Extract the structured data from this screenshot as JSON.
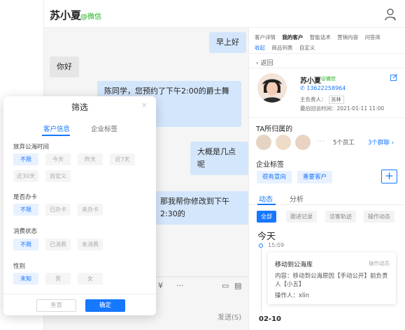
{
  "chat": {
    "contact_name": "苏小夏",
    "contact_tag": "@微信",
    "messages": [
      {
        "from": "me",
        "text": "早上好"
      },
      {
        "from": "other",
        "text": "你好"
      },
      {
        "from": "me",
        "text": "陈同学，您预约了下午2:00的爵士舞基础课程",
        "text2": "课噢"
      },
      {
        "from": "me",
        "text": "大概是几点呢"
      },
      {
        "from": "me",
        "text": "那我帮你修改到下午2:30的"
      }
    ],
    "send_label": "发送(S)"
  },
  "panel": {
    "tabs": [
      "客户详情",
      "我的客户",
      "智能话术",
      "营销内容",
      "问答库",
      "收起",
      "商品列表",
      "自定义"
    ],
    "active_tab": "我的客户",
    "back_label": "返回",
    "profile": {
      "name": "苏小夏",
      "tag": "@微信",
      "phone": "13622258964",
      "owner_label": "主负责人：",
      "owner": "苏林",
      "last_visit_label": "最后回访时间：",
      "last_visit": "2021-01-11 11:00"
    },
    "belongs_title": "TA所归属的",
    "staff_count": "5个员工",
    "group_count": "3个群聊",
    "tags_title": "企业标签",
    "tags": [
      "很有意向",
      "重要客户"
    ],
    "add_symbol": "+",
    "subtabs": [
      "动态",
      "分析"
    ],
    "chips": [
      "全部",
      "跟进记录",
      "访客轨迹",
      "操作动态"
    ],
    "today_label": "今天",
    "timeline": {
      "time": "15:09",
      "title": "移动到公海库",
      "type": "操作动态",
      "content": "内容：移动到公海原因【手动公开】前负责人【小五】",
      "operator": "操作人：xlin"
    },
    "next_date": "02-10"
  },
  "filter": {
    "title": "筛选",
    "close": "×",
    "tabs": [
      "客户信息",
      "企业标签"
    ],
    "sections": [
      {
        "label": "放弃公海时间",
        "options": [
          "不限",
          "今天",
          "昨天",
          "近7天",
          "近30天",
          "自定义"
        ]
      },
      {
        "label": "是否办卡",
        "options": [
          "不限",
          "已办卡",
          "未办卡"
        ]
      },
      {
        "label": "消费状态",
        "options": [
          "不限",
          "已消费",
          "未消费"
        ]
      },
      {
        "label": "性别",
        "options": [
          "未知",
          "男",
          "女"
        ]
      }
    ],
    "reset_label": "重置",
    "confirm_label": "确定"
  },
  "colors": {
    "accent": "#1677ff",
    "wechat_green": "#1aad19",
    "bubble_me": "#d4e6fb",
    "bubble_other": "#e6e6e6"
  }
}
